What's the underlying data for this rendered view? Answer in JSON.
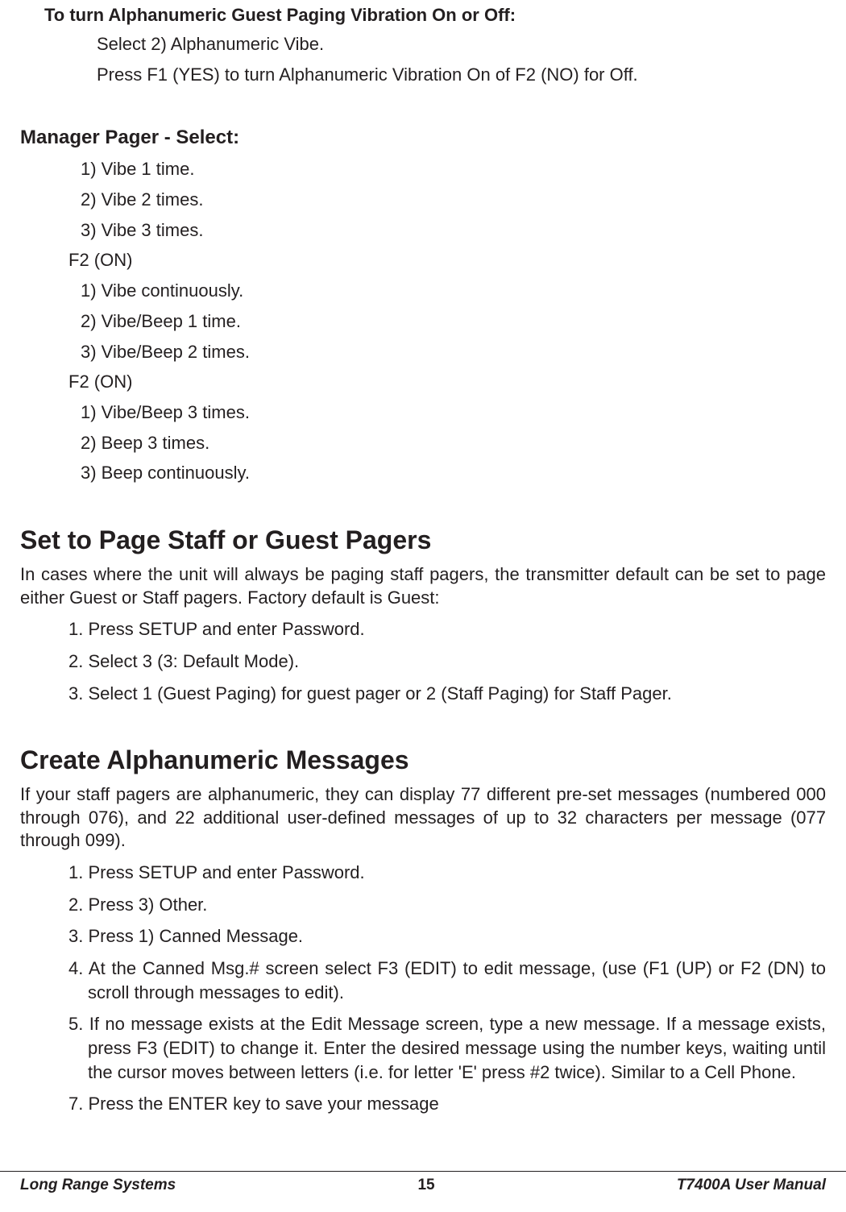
{
  "top": {
    "heading": "To turn Alphanumeric Guest Paging Vibration On or Off:",
    "lines": [
      "Select 2) Alphanumeric Vibe.",
      "Press F1 (YES) to turn Alphanumeric Vibration On of F2 (NO) for Off."
    ]
  },
  "manager": {
    "title": "Manager Pager - Select:",
    "group1": [
      "1) Vibe 1 time.",
      "2) Vibe 2 times.",
      "3) Vibe 3 times."
    ],
    "f2a": "F2 (ON)",
    "group2": [
      "1) Vibe continuously.",
      "2) Vibe/Beep 1 time.",
      "3) Vibe/Beep 2 times."
    ],
    "f2b": "F2 (ON)",
    "group3": [
      "1) Vibe/Beep 3 times.",
      "2) Beep 3 times.",
      "3) Beep continuously."
    ]
  },
  "setPage": {
    "title": "Set to Page Staff or Guest Pagers",
    "intro": "In cases where the unit will always be paging staff pagers, the transmitter default can be set to page either Guest or Staff pagers.  Factory default is Guest:",
    "steps": [
      "1. Press SETUP and enter Password.",
      "2. Select 3 (3: Default Mode).",
      "3. Select 1 (Guest Paging) for guest pager or 2 (Staff Paging) for Staff Pager."
    ]
  },
  "createMsg": {
    "title": "Create Alphanumeric Messages",
    "intro": "If your staff pagers are alphanumeric, they can display 77 different pre-set messages (numbered 000 through 076), and 22 additional user-defined messages of up to 32 characters per message (077 through 099).",
    "steps": [
      "1. Press SETUP and enter Password.",
      "2. Press 3) Other.",
      "3. Press 1) Canned Message.",
      "4. At the Canned Msg.# screen select F3 (EDIT) to edit message, (use (F1 (UP) or F2 (DN) to scroll through messages to edit).",
      "5. If no message exists at the Edit Message screen, type a new message. If a message exists, press F3 (EDIT) to change it. Enter the desired message using the number keys, waiting until the cursor moves between letters (i.e. for letter 'E' press #2 twice). Similar to a Cell Phone.",
      "7. Press the ENTER key to save your message"
    ]
  },
  "footer": {
    "left": "Long Range Systems",
    "center": "15",
    "right": "T7400A User Manual"
  }
}
